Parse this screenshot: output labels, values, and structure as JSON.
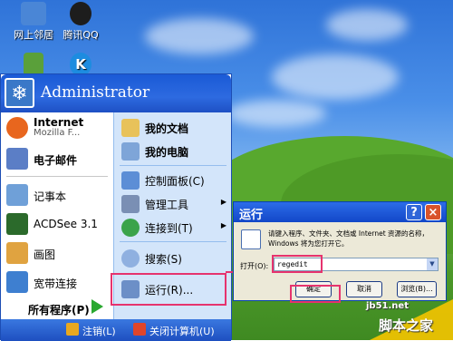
{
  "desktop": {
    "icons": [
      {
        "label": "网上邻居",
        "icon": "network-places-icon",
        "color": "#4a86d6"
      },
      {
        "label": "腾讯QQ",
        "icon": "qq-penguin-icon",
        "color": "#1d1d1d"
      },
      {
        "label": "",
        "icon": "recycle-icon",
        "color": "#5aa03a"
      },
      {
        "label": "",
        "icon": "kugou-icon",
        "color": "#1d8ce0"
      }
    ]
  },
  "start_menu": {
    "user": "Administrator",
    "left_items": [
      {
        "label": "Internet",
        "sub": "Mozilla F...",
        "icon": "firefox-icon",
        "color": "#e8661e"
      },
      {
        "label": "电子邮件",
        "icon": "mail-icon",
        "color": "#5b7ec6"
      },
      {
        "label": "记事本",
        "icon": "notepad-icon",
        "color": "#6fa0d8"
      },
      {
        "label": "ACDSee 3.1",
        "icon": "acdsee-eye-icon",
        "color": "#2b6a2b"
      },
      {
        "label": "画图",
        "icon": "paint-icon",
        "color": "#e0a340"
      },
      {
        "label": "宽带连接",
        "icon": "broadband-icon",
        "color": "#3e7fd0"
      }
    ],
    "all_programs": "所有程序(P)",
    "right_items": [
      {
        "label": "我的文档",
        "icon": "my-documents-icon",
        "color": "#e8c25a",
        "arrow": ""
      },
      {
        "label": "我的电脑",
        "icon": "my-computer-icon",
        "color": "#7ea5d8",
        "arrow": ""
      },
      {
        "label": "控制面板(C)",
        "icon": "control-panel-icon",
        "color": "#5c8ed6",
        "arrow": ""
      },
      {
        "label": "管理工具",
        "icon": "admin-tools-icon",
        "color": "#7a8fb4",
        "arrow": "▶"
      },
      {
        "label": "连接到(T)",
        "icon": "connect-to-icon",
        "color": "#3aa34a",
        "arrow": "▶"
      },
      {
        "label": "搜索(S)",
        "icon": "search-icon",
        "color": "#8fb0e0",
        "arrow": ""
      },
      {
        "label": "运行(R)...",
        "icon": "run-icon",
        "color": "#6c8fc7",
        "arrow": ""
      }
    ],
    "logoff": "注销(L)",
    "shutdown": "关闭计算机(U)"
  },
  "run_dialog": {
    "title": "运行",
    "help": "?",
    "close": "×",
    "description": "请键入程序、文件夹、文档或 Internet 资源的名称，Windows 将为您打开它。",
    "open_label": "打开(O):",
    "input_value": "regedit",
    "ok": "确定",
    "cancel": "取消",
    "browse": "浏览(B)..."
  },
  "watermark": {
    "url": "jb51.net",
    "name": "脚本之家"
  },
  "colors": {
    "highlight": "#e6336e",
    "xp_blue": "#1a5ad6"
  }
}
